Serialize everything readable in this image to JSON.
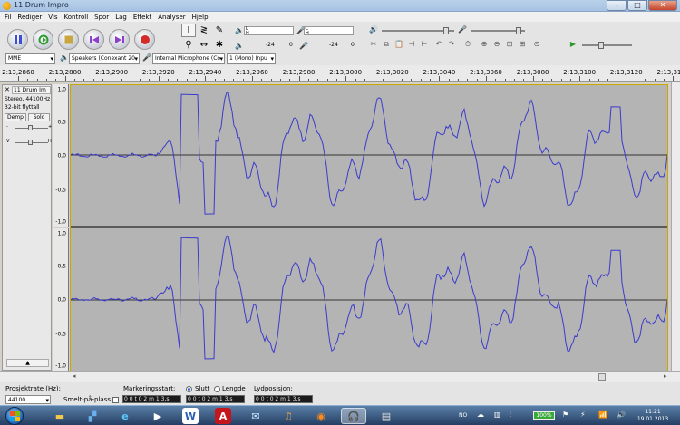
{
  "window": {
    "title": "11 Drum Impro",
    "minimize": "–",
    "maximize": "□",
    "close": "✕"
  },
  "menu": [
    "Fil",
    "Rediger",
    "Vis",
    "Kontroll",
    "Spor",
    "Lag",
    "Effekt",
    "Analyser",
    "Hjelp"
  ],
  "transport": [
    "pause",
    "loop",
    "stop",
    "skip-start",
    "skip-end",
    "record"
  ],
  "meters": {
    "playback_scale": [
      "-24",
      "0"
    ],
    "record_scale": [
      "-24",
      "0"
    ],
    "l_label": "L",
    "r_label": "H"
  },
  "devices": {
    "host": "MME",
    "output": "Speakers (Conexant 20",
    "input": "Internal Microphone (Co",
    "channels": "1 (Mono) Inpu"
  },
  "ruler": {
    "labels": [
      "2:13,2860",
      "2:13,2880",
      "2:13,2900",
      "2:13,2920",
      "2:13,2940",
      "2:13,2960",
      "2:13,2980",
      "2:13,3000",
      "2:13,3020",
      "2:13,3040",
      "2:13,3060",
      "2:13,3080",
      "2:13,3100",
      "2:13,3120",
      "2:13,3140"
    ]
  },
  "track": {
    "name": "11 Drum Im",
    "info1": "Stereo, 44100Hz",
    "info2": "32-bit flyttall",
    "mute": "Demp",
    "solo": "Solo",
    "gain_left": "-",
    "gain_right": "+",
    "pan_left": "V",
    "pan_right": "H",
    "collapse": "▲",
    "scale": [
      "1,0",
      "0,5",
      "0,0",
      "-0,5",
      "-1,0"
    ]
  },
  "selection": {
    "rate_label": "Prosjektrate (Hz):",
    "rate_value": "44100",
    "snap_label": "Smelt-på-plass",
    "start_label": "Markeringsstart:",
    "end_label": "Slutt",
    "length_label": "Lengde",
    "pos_label": "Lydposisjon:",
    "start_value": "0 0 t 0 2 m 1 3,s",
    "end_value": "0 0 t 0 2 m 1 3,s",
    "pos_value": "0 0 t 0 2 m 1 3,s"
  },
  "taskbar": {
    "lang": "NO",
    "battery": "100%",
    "time": "11:21",
    "date": "19.01.2013"
  }
}
